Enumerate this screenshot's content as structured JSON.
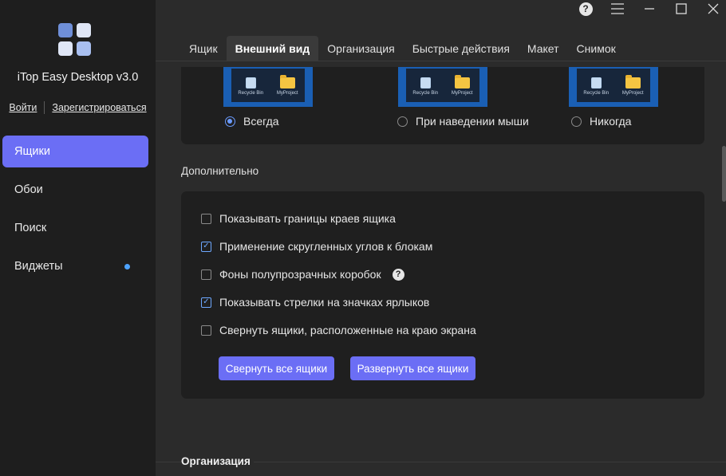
{
  "app": {
    "title": "iTop Easy Desktop v3.0",
    "login": "Войти",
    "register": "Зарегистрироваться",
    "accent": "#6b6ef5"
  },
  "sidebar": {
    "items": [
      {
        "label": "Ящики",
        "active": true
      },
      {
        "label": "Обои"
      },
      {
        "label": "Поиск"
      },
      {
        "label": "Виджеты",
        "badge_dot": true
      }
    ]
  },
  "window": {
    "help": "?",
    "icons": [
      "help-icon",
      "menu-icon",
      "minimize-icon",
      "maximize-icon",
      "close-icon"
    ]
  },
  "tabs": [
    {
      "label": "Ящик"
    },
    {
      "label": "Внешний вид",
      "active": true
    },
    {
      "label": "Организация"
    },
    {
      "label": "Быстрые действия"
    },
    {
      "label": "Макет"
    },
    {
      "label": "Снимок"
    }
  ],
  "display_mode": {
    "preview_labels": {
      "recycle": "Recycle Bin",
      "project": "MyProject"
    },
    "options": [
      {
        "label": "Всегда",
        "selected": true
      },
      {
        "label": "При наведении мыши",
        "selected": false
      },
      {
        "label": "Никогда",
        "selected": false
      }
    ]
  },
  "advanced": {
    "title": "Дополнительно",
    "options": [
      {
        "label": "Показывать границы краев ящика",
        "checked": false
      },
      {
        "label": "Применение скругленных углов к блокам",
        "checked": true
      },
      {
        "label": "Фоны полупрозрачных коробок",
        "checked": false,
        "help": "?"
      },
      {
        "label": "Показывать стрелки на значках ярлыков",
        "checked": true
      },
      {
        "label": "Свернуть ящики, расположенные на краю экрана",
        "checked": false
      }
    ],
    "collapse_all": "Свернуть все ящики",
    "expand_all": "Развернуть все ящики"
  },
  "next_section": {
    "title": "Организация"
  }
}
